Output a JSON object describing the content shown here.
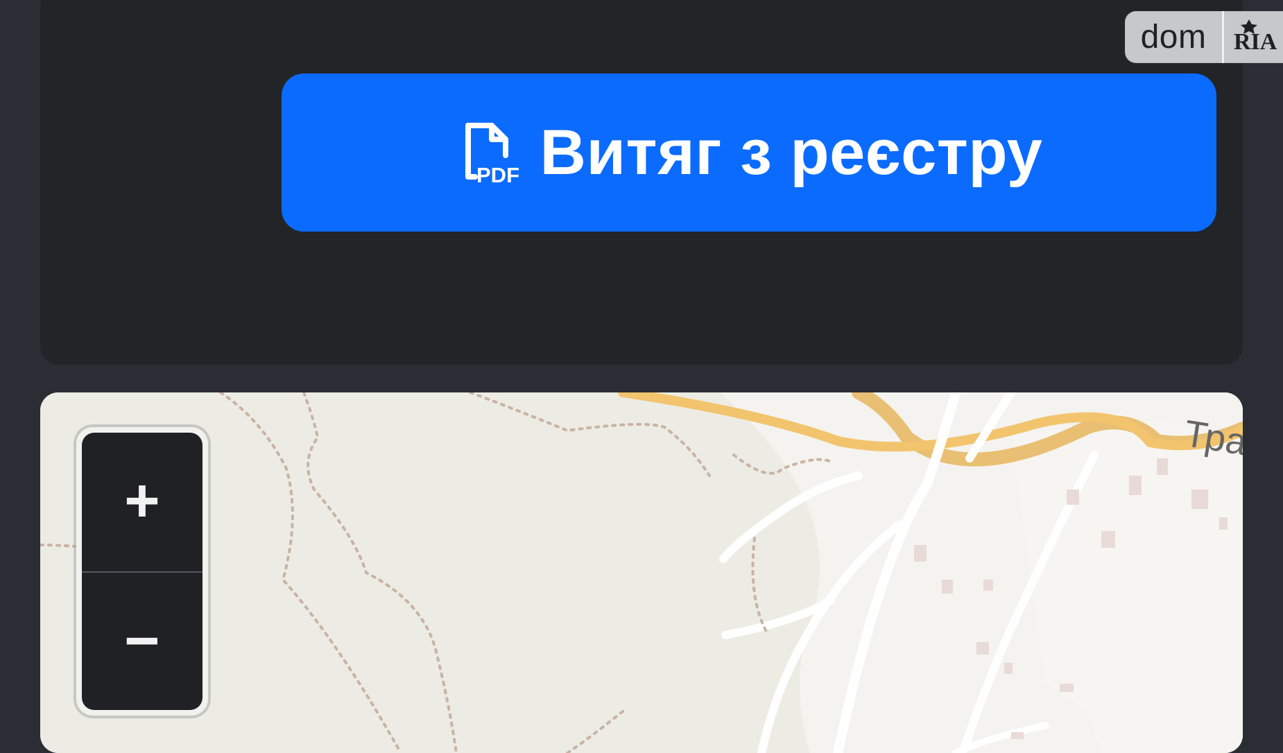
{
  "brand": {
    "dom_text": "dom",
    "ria_text": "RIA"
  },
  "registry_button": {
    "pdf_badge": "PDF",
    "label": "Витяг з реєстру"
  },
  "map": {
    "road_label": "Тра",
    "zoom_in_label": "+",
    "zoom_out_label": "−"
  },
  "colors": {
    "page_bg": "#2a2d33",
    "card_bg": "#222428",
    "button_bg": "#0b6bff",
    "button_text": "#ffffff",
    "map_bg": "#ecece4",
    "road_major": "#f2c46d",
    "road_minor": "#ffffff"
  },
  "icons": {
    "pdf": "pdf-file-icon",
    "ria_logo": "ria-logo-icon"
  }
}
